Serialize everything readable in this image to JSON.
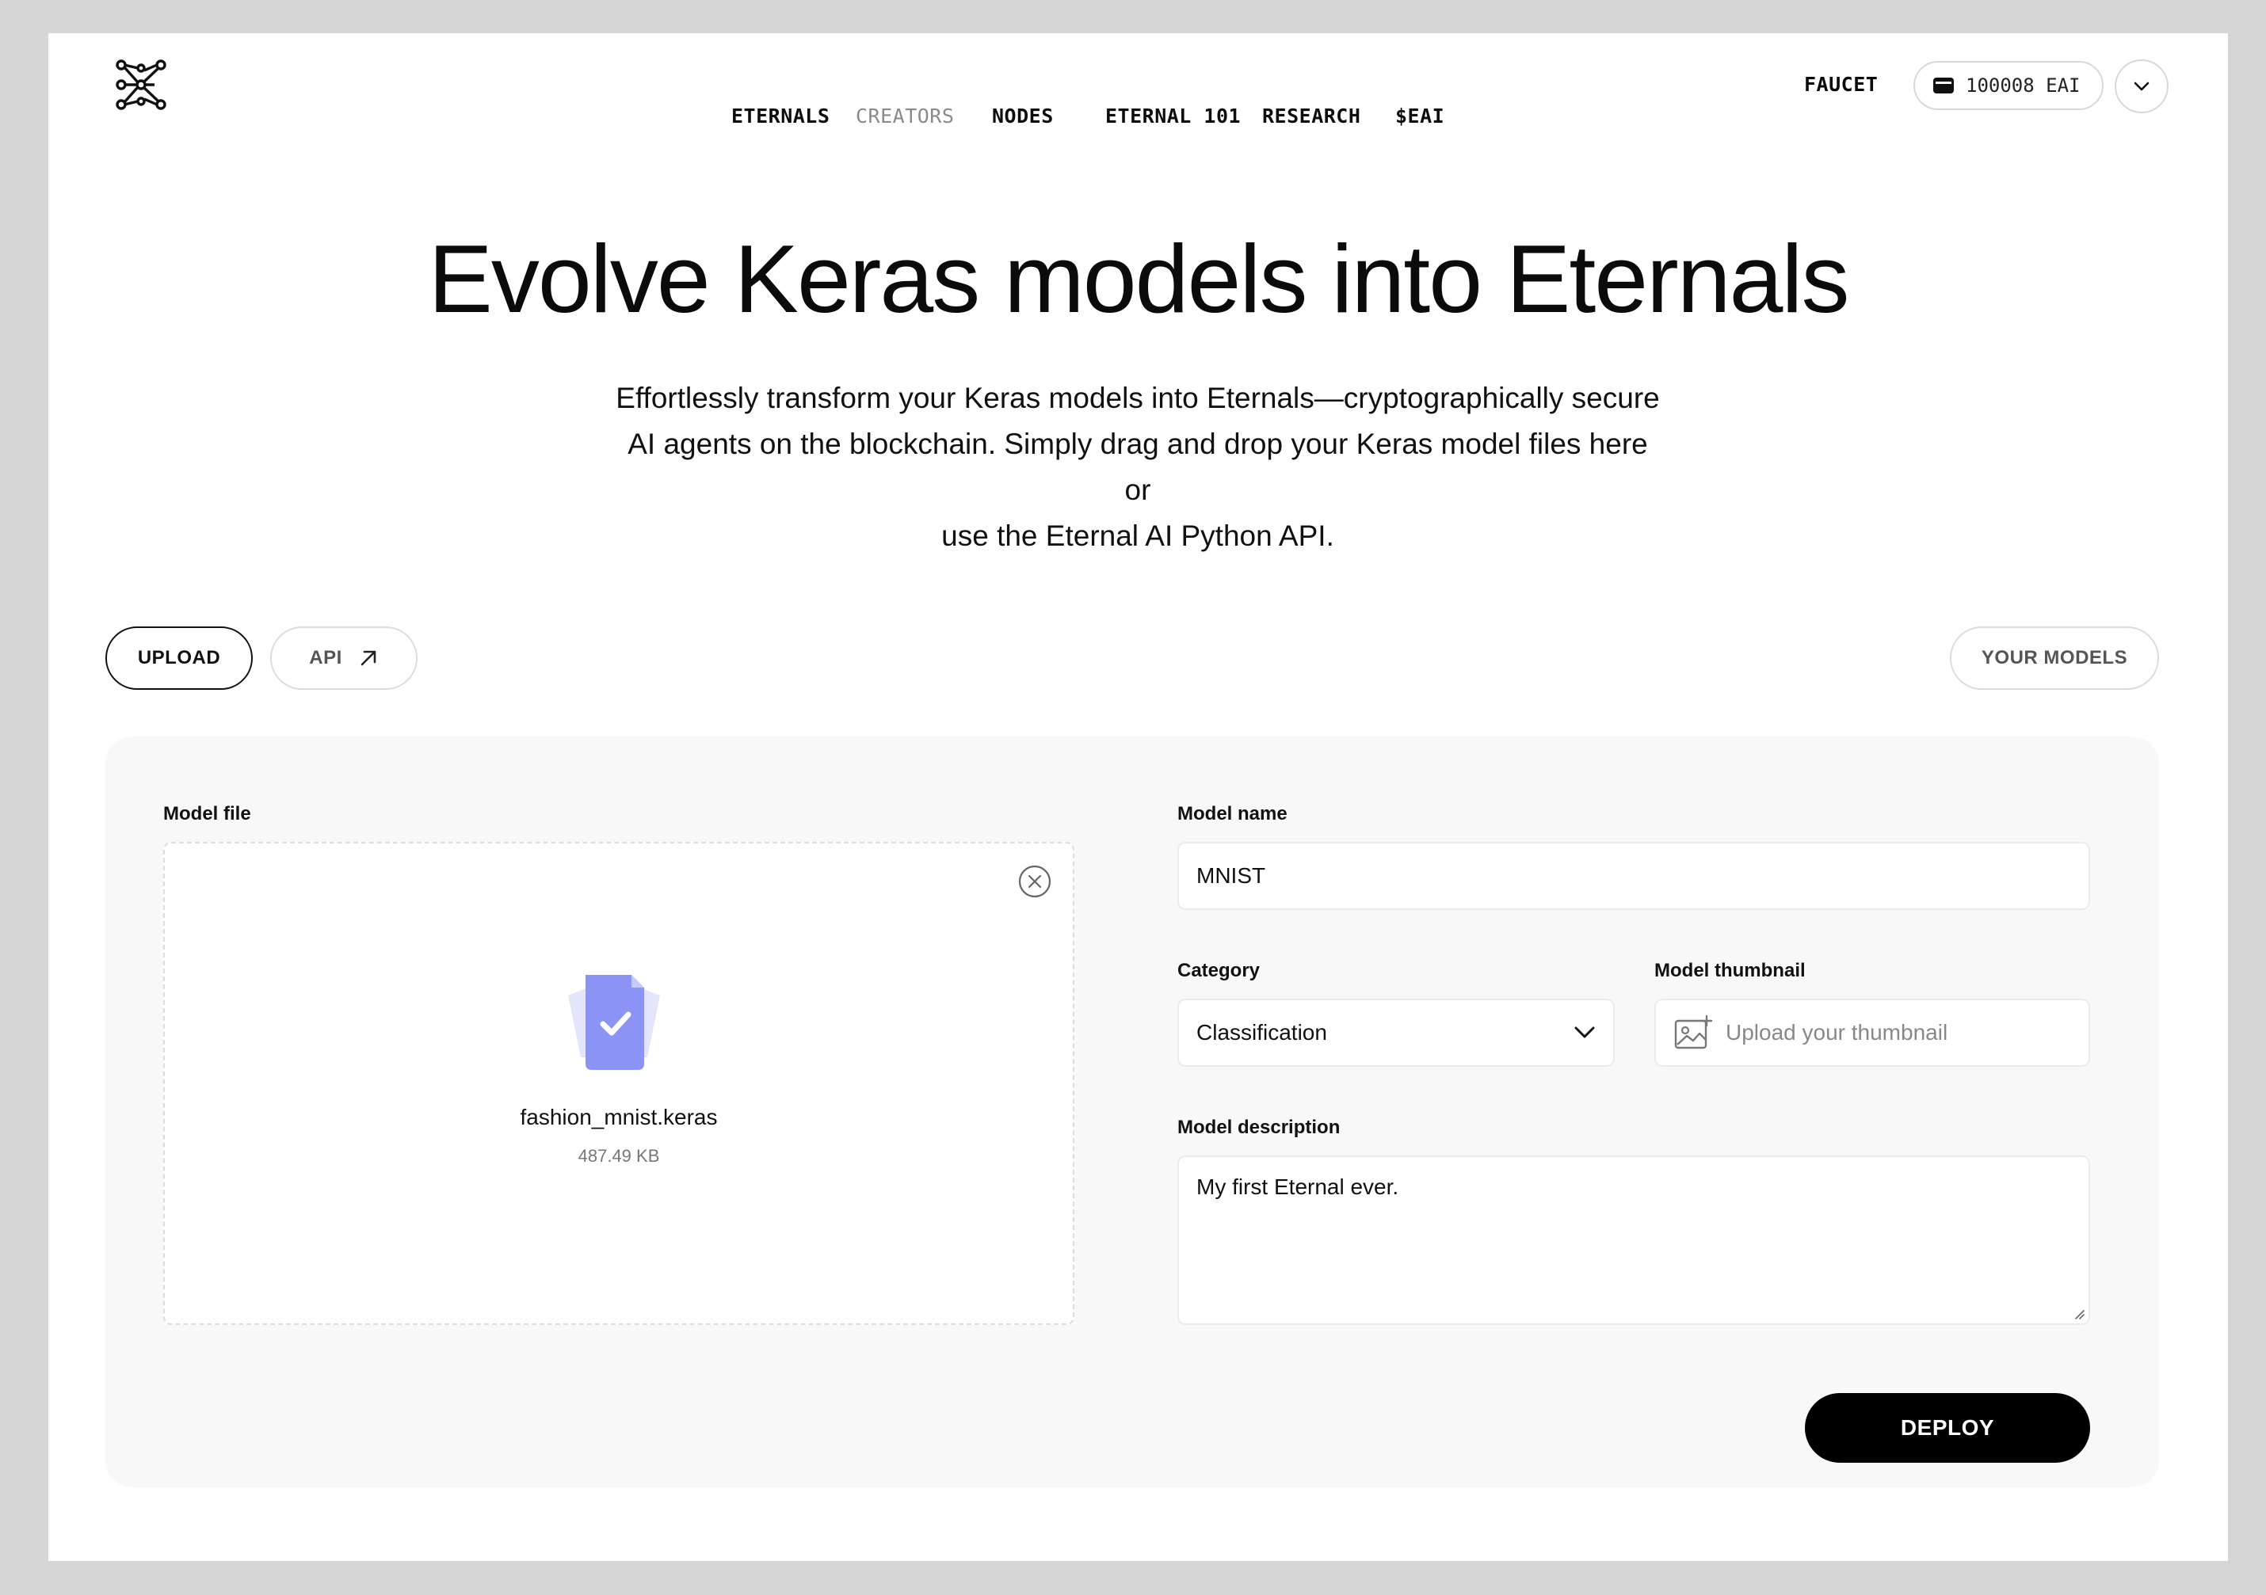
{
  "nav": {
    "items": [
      {
        "label": "ETERNALS",
        "active": false
      },
      {
        "label": "CREATORS",
        "active": false,
        "muted": true
      },
      {
        "label": "NODES",
        "active": false
      },
      {
        "label": "ETERNAL 101",
        "active": false
      },
      {
        "label": "RESEARCH",
        "active": false
      },
      {
        "label": "$EAI",
        "active": false
      }
    ],
    "faucet_label": "FAUCET",
    "wallet_balance": "100008 EAI",
    "icons": {
      "logo": "eternal-ai-logo",
      "wallet": "wallet-icon",
      "account": "chevron-down-icon"
    }
  },
  "hero": {
    "title": "Evolve Keras models into Eternals",
    "subtitle_lines": [
      "Effortlessly transform your Keras models into Eternals—cryptographically secure",
      "AI agents on the blockchain. Simply drag and drop your Keras model files here or",
      "use the Eternal AI Python API."
    ]
  },
  "tabs": {
    "upload_label": "UPLOAD",
    "api_label": "API",
    "your_models_label": "YOUR MODELS"
  },
  "form": {
    "model_file": {
      "label": "Model file",
      "file_name": "fashion_mnist.keras",
      "file_size": "487.49 KB"
    },
    "model_name": {
      "label": "Model name",
      "value": "MNIST"
    },
    "category": {
      "label": "Category",
      "value": "Classification"
    },
    "thumbnail": {
      "label": "Model thumbnail",
      "placeholder": "Upload your thumbnail"
    },
    "description": {
      "label": "Model description",
      "value": "My first Eternal ever."
    },
    "deploy_label": "DEPLOY"
  },
  "colors": {
    "background": "#d6d6d6",
    "panel": "#f8f8f8",
    "accent_file": "#8b93f5",
    "accent_file_light": "#e3e5fd",
    "deploy": "#000000"
  }
}
